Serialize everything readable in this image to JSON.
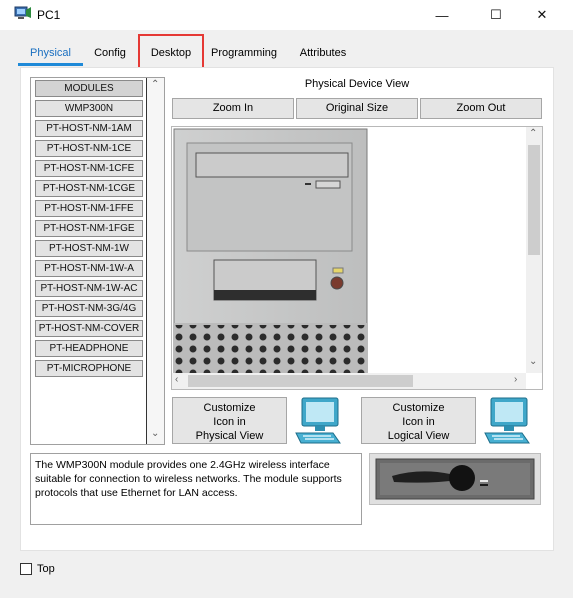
{
  "window": {
    "title": "PC1",
    "minimize_glyph": "—",
    "maximize_glyph": "☐",
    "close_glyph": "✕"
  },
  "tabs": [
    {
      "label": "Physical",
      "active": true
    },
    {
      "label": "Config",
      "active": false
    },
    {
      "label": "Desktop",
      "active": false
    },
    {
      "label": "Programming",
      "active": false
    },
    {
      "label": "Attributes",
      "active": false
    }
  ],
  "modules": [
    "MODULES",
    "WMP300N",
    "PT-HOST-NM-1AM",
    "PT-HOST-NM-1CE",
    "PT-HOST-NM-1CFE",
    "PT-HOST-NM-1CGE",
    "PT-HOST-NM-1FFE",
    "PT-HOST-NM-1FGE",
    "PT-HOST-NM-1W",
    "PT-HOST-NM-1W-A",
    "PT-HOST-NM-1W-AC",
    "PT-HOST-NM-3G/4G",
    "PT-HOST-NM-COVER",
    "PT-HEADPHONE",
    "PT-MICROPHONE"
  ],
  "device_view": {
    "title": "Physical Device View",
    "zoom_in": "Zoom In",
    "original_size": "Original Size",
    "zoom_out": "Zoom Out"
  },
  "customize": {
    "physical_line1": "Customize",
    "physical_line2": "Icon in",
    "physical_line3": "Physical View",
    "logical_line1": "Customize",
    "logical_line2": "Icon in",
    "logical_line3": "Logical View"
  },
  "description": "The WMP300N module provides one 2.4GHz wireless interface suitable for connection to wireless networks. The module supports protocols that use Ethernet for LAN access.",
  "bottom": {
    "top_label": "Top",
    "top_checked": false
  },
  "colors": {
    "accent": "#1f8ad8",
    "highlight": "#e53935"
  }
}
